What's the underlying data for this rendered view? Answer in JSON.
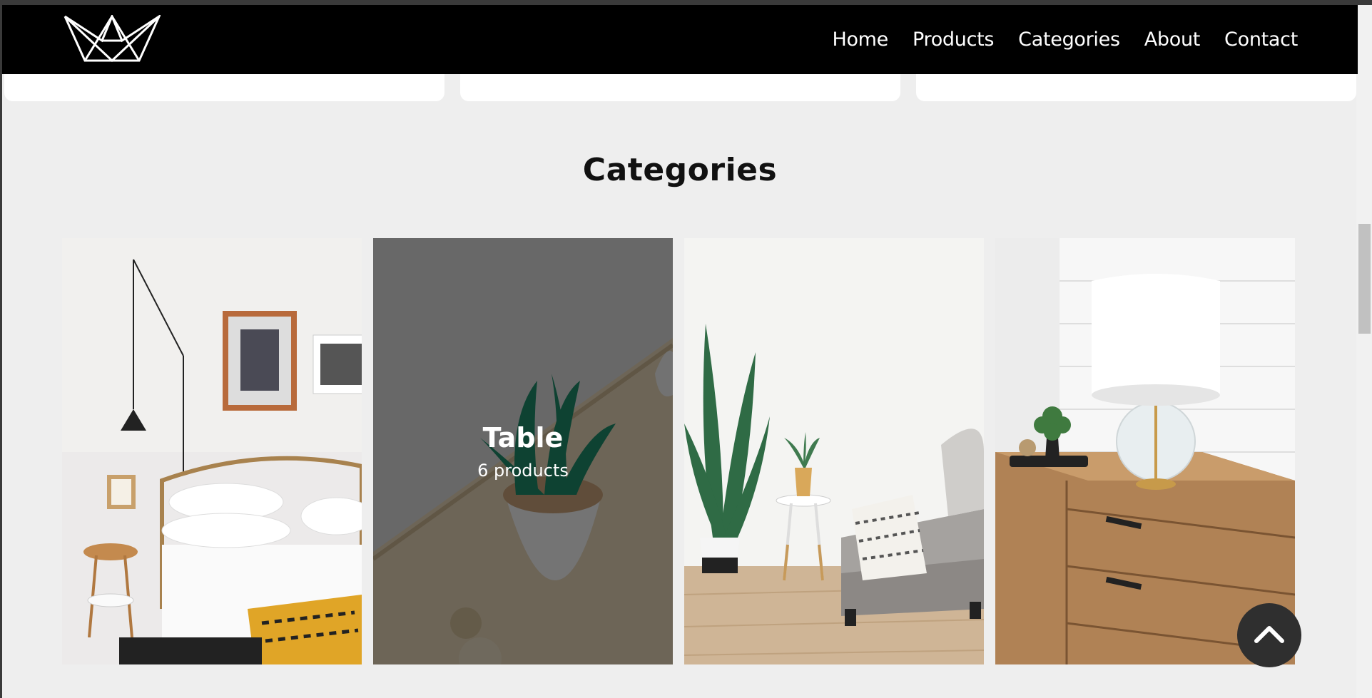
{
  "nav": {
    "links": [
      "Home",
      "Products",
      "Categories",
      "About",
      "Contact"
    ]
  },
  "icons": {
    "logo": "crown-logo",
    "back_to_top": "chevron-up-icon"
  },
  "categories": {
    "title": "Categories",
    "tiles": [
      {
        "image": "bedroom-photo",
        "name": "",
        "count": ""
      },
      {
        "image": "plant-on-table-photo",
        "name": "Table",
        "count": "6 products"
      },
      {
        "image": "living-room-photo",
        "name": "",
        "count": ""
      },
      {
        "image": "dresser-lamp-photo",
        "name": "",
        "count": ""
      }
    ]
  },
  "colors": {
    "nav_bg": "#000000",
    "page_bg": "#eeeeee",
    "overlay": "rgba(0,0,0,0.52)"
  }
}
